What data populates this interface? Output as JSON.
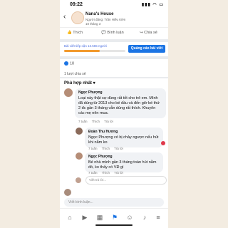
{
  "status_bar": {
    "time": "09:22"
  },
  "post": {
    "page_name": "Nana's House",
    "meta_line": "Người đăng: Trần Hiếu Kiên",
    "date": "10 tháng 3"
  },
  "actions": {
    "like": "Thích",
    "comment": "Bình luận",
    "share": "Chia sẻ"
  },
  "boost": {
    "reach_text": "Bài viết tiếp cận 13.565 người",
    "progress": 0.58,
    "button": "Quảng cáo bài viết"
  },
  "stats": {
    "likes": "18",
    "shares": "1 lượt chia sẻ"
  },
  "comments": {
    "sort": "Phù hợp nhất",
    "items": [
      {
        "name": "Ngọc Phượng",
        "text": "Loại này thật sự dùng rất tốt cho trẻ em. Mình đã dùng từ 2013 cho bé đầu và đến giờ bé thứ 2 đc gần 3 tháng vẫn dùng rất thích. Khuyên các mẹ nên mua.",
        "time": "7 tuần",
        "like": "Thích",
        "reply": "Trả lời"
      },
      {
        "name": "Đoàn Thu Hương",
        "text": "Ngọc Phượng  có bị chảy ngược nếu hút khi nằm ko",
        "time": "7 tuần",
        "like": "Thích",
        "reply": "Trả lời"
      },
      {
        "name": "Ngọc Phượng",
        "text": "Bé nhà mình gần 3 tháng toàn hút nằm đó, ko thấy có VĐ gì",
        "time": "7 tuần",
        "like": "Thích",
        "reply": "Trả lời"
      }
    ],
    "reply_placeholder": "Viết trả lời...",
    "composer_placeholder": "Viết bình luận..."
  },
  "colors": {
    "accent": "#1b74e4",
    "progress": "#f29a2e"
  },
  "tabs": [
    "home-icon",
    "video-icon",
    "store-icon",
    "flag-icon",
    "groups-icon",
    "bell-icon",
    "menu-icon"
  ]
}
